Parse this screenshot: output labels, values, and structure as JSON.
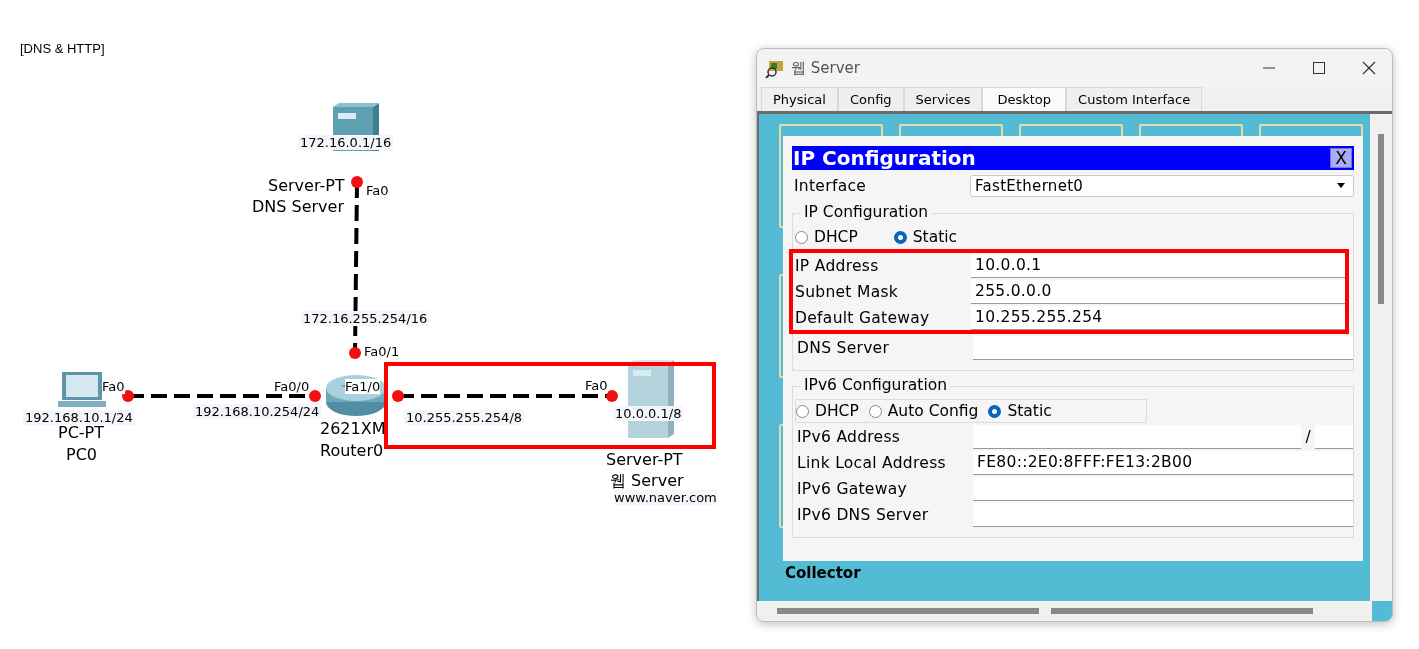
{
  "canvas_title": "[DNS & HTTP]",
  "devices": [
    {
      "kind": "server",
      "model": "Server-PT",
      "name": "DNS Server"
    },
    {
      "kind": "pc",
      "model": "PC-PT",
      "name": "PC0"
    },
    {
      "kind": "router",
      "model": "2621XM",
      "name": "Router0"
    },
    {
      "kind": "server",
      "model": "Server-PT",
      "name": "웹 Server",
      "note": "www.naver.com"
    }
  ],
  "addresses": [
    "172.16.0.1/16",
    "172.16.255.254/16",
    "192.168.10.1/24",
    "192.168.10.254/24",
    "10.255.255.254/8",
    "10.0.0.1/8"
  ],
  "ports": [
    "Fa0",
    "Fa0/1",
    "Fa0",
    "Fa0/0",
    "Fa1/0",
    "Fa0"
  ],
  "window": {
    "title": "웹 Server",
    "tabs": [
      {
        "label": "Physical",
        "selected": false
      },
      {
        "label": "Config",
        "selected": false
      },
      {
        "label": "Services",
        "selected": false
      },
      {
        "label": "Desktop",
        "selected": true
      },
      {
        "label": "Custom Interface",
        "selected": false
      }
    ],
    "desktop_label": "Collector",
    "dialog": {
      "title": "IP Configuration",
      "close": "X",
      "interface": {
        "label": "Interface",
        "value": "FastEthernet0"
      },
      "ipv4": {
        "legend": "IP Configuration",
        "modes": [
          {
            "label": "DHCP",
            "selected": false
          },
          {
            "label": "Static",
            "selected": true
          }
        ],
        "fields": [
          {
            "label": "IP Address",
            "value": "10.0.0.1",
            "highlighted": true
          },
          {
            "label": "Subnet Mask",
            "value": "255.0.0.0",
            "highlighted": true
          },
          {
            "label": "Default Gateway",
            "value": "10.255.255.254",
            "highlighted": true
          },
          {
            "label": "DNS Server",
            "highlighted": false
          }
        ]
      },
      "ipv6": {
        "legend": "IPv6 Configuration",
        "modes": [
          {
            "label": "DHCP",
            "selected": false
          },
          {
            "label": "Auto Config",
            "selected": false
          },
          {
            "label": "Static",
            "selected": true
          }
        ],
        "fields": [
          {
            "label": "IPv6 Address",
            "prefix": "/"
          },
          {
            "label": "Link Local Address",
            "value": "FE80::2E0:8FFF:FE13:2B00"
          },
          {
            "label": "IPv6 Gateway"
          },
          {
            "label": "IPv6 DNS Server"
          }
        ]
      }
    }
  }
}
